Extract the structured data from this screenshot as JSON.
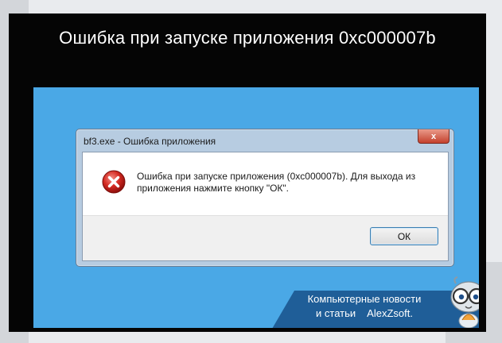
{
  "article": {
    "headline": "Ошибка при запуске приложения 0xc000007b"
  },
  "dialog": {
    "title": "bf3.exe - Ошибка приложения",
    "close_glyph": "x",
    "message_line1": "Ошибка при запуске приложения (0xc000007b). Для выхода из",
    "message_line2": "приложения нажмите кнопку \"ОК\".",
    "ok_label": "ОК",
    "icon": "error-icon"
  },
  "branding": {
    "line1": "Компьютерные новости",
    "line2a": "и статьи",
    "line2b": "AlexZsoft."
  },
  "colors": {
    "desktop": "#4aa8e6",
    "frame": "#050505",
    "banner": "#1f5e98",
    "error_red": "#c4161c"
  }
}
